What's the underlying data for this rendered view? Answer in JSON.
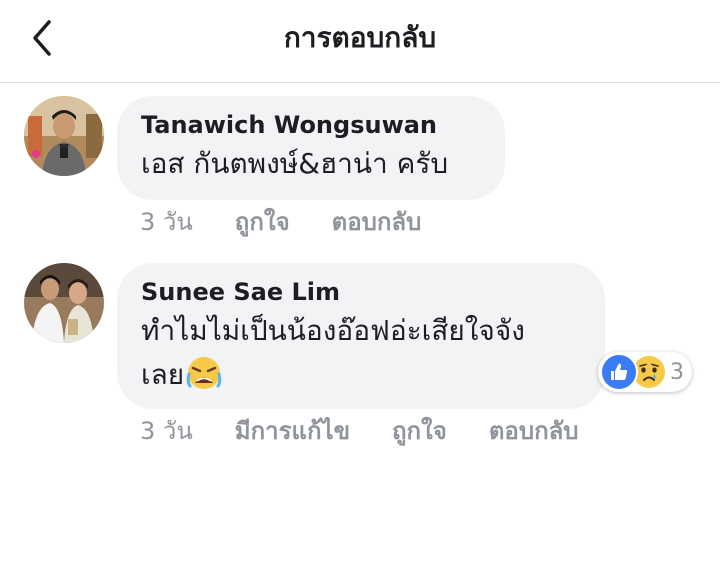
{
  "header": {
    "title": "การตอบกลับ"
  },
  "comments": [
    {
      "author": "Tanawich Wongsuwan",
      "lines": [
        "เอส กันตพงษ์&ฮาน่า ครับ"
      ],
      "time": "3 วัน",
      "like_label": "ถูกใจ",
      "reply_label": "ตอบกลับ"
    },
    {
      "author": "Sunee Sae Lim",
      "lines": [
        "ทำไมไม่เป็นน้องอ๊อฟอ่ะเสียใจจัง",
        "เลย"
      ],
      "emoji": "tired-crying-face",
      "time": "3 วัน",
      "edited_label": "มีการแก้ไข",
      "like_label": "ถูกใจ",
      "reply_label": "ตอบกลับ",
      "reactions": {
        "types": [
          "like",
          "sad"
        ],
        "count": "3"
      }
    }
  ],
  "colors": {
    "bubble": "#f2f3f5",
    "meta": "#90949c",
    "like_blue": "#3b7cf5",
    "sad_yellow": "#f7c948"
  }
}
